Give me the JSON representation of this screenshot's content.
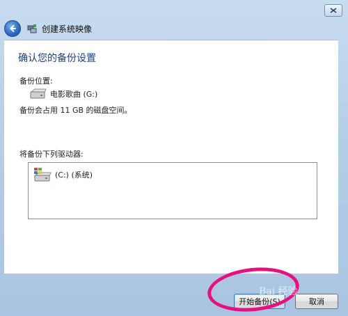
{
  "window": {
    "title": "创建系统映像"
  },
  "main": {
    "heading": "确认您的备份设置",
    "location_label": "备份位置:",
    "target_drive": "电影歌曲 (G:)",
    "space_note": "备份会占用 11 GB 的磁盘空间。",
    "drives_label": "将备份下列驱动器:",
    "drives": [
      {
        "label": "(C:) (系统)",
        "icon": "windows-drive-icon"
      }
    ]
  },
  "footer": {
    "start_label": "开始备份(S)",
    "cancel_label": "取消"
  },
  "annotation": {
    "watermark": "Bai 经验",
    "ring_color": "#e8107e"
  },
  "colors": {
    "heading": "#1f3f8a",
    "frame": "#b6cfe8",
    "back_button": "#2e6dc6"
  }
}
